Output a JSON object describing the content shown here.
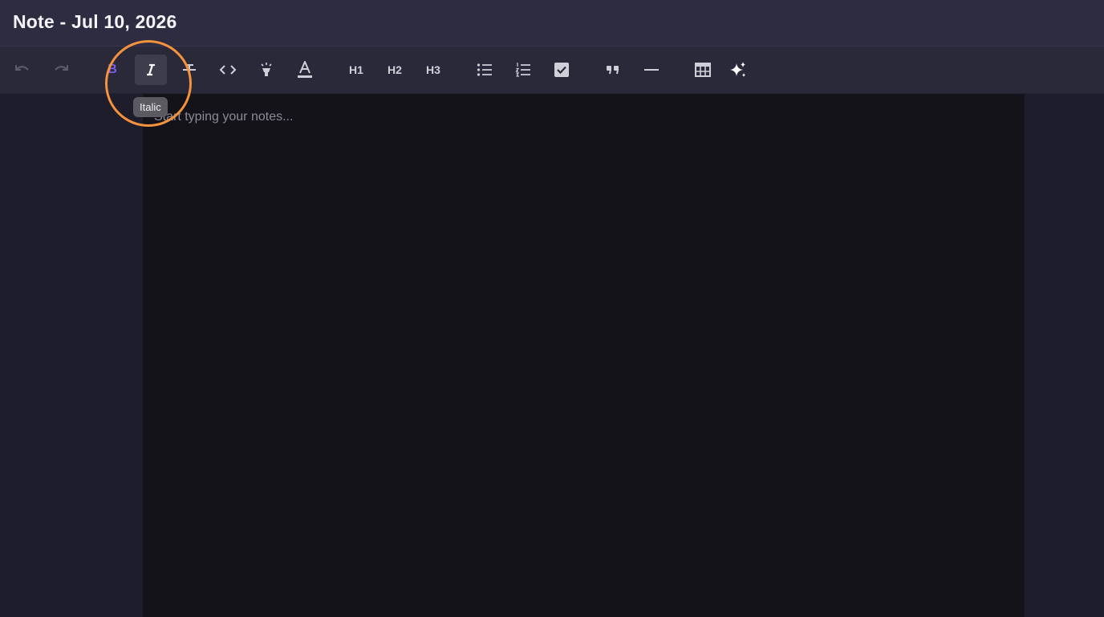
{
  "header": {
    "title": "Note - Jul 10, 2026"
  },
  "toolbar": {
    "undo_icon": "undo-icon",
    "redo_icon": "redo-icon",
    "bold_label": "B",
    "h1_label": "H1",
    "h2_label": "H2",
    "h3_label": "H3",
    "active_button": "italic",
    "accent_color": "#7c5cf0"
  },
  "tooltip": {
    "text": "Italic"
  },
  "editor": {
    "placeholder": "Start typing your notes..."
  },
  "highlight": {
    "color": "#f5923e"
  }
}
